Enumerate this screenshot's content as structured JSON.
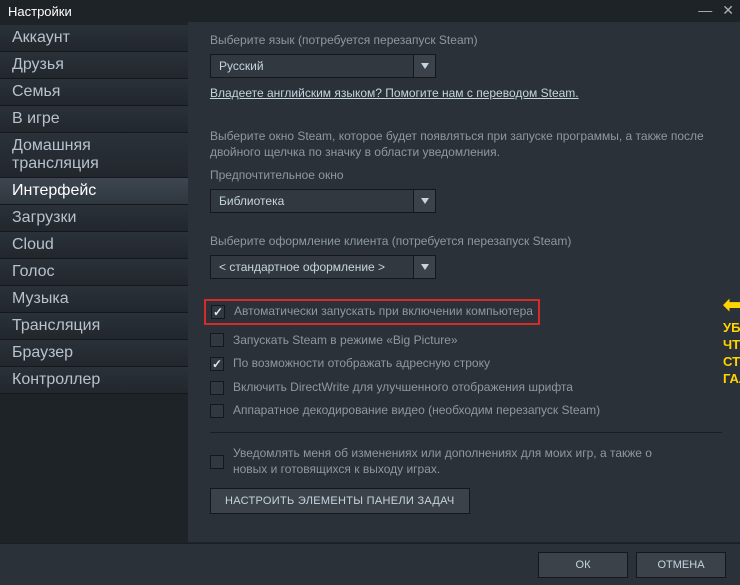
{
  "window": {
    "title": "Настройки"
  },
  "sidebar": {
    "items": [
      {
        "label": "Аккаунт"
      },
      {
        "label": "Друзья"
      },
      {
        "label": "Семья"
      },
      {
        "label": "В игре"
      },
      {
        "label": "Домашняя трансляция"
      },
      {
        "label": "Интерфейс"
      },
      {
        "label": "Загрузки"
      },
      {
        "label": "Cloud"
      },
      {
        "label": "Голос"
      },
      {
        "label": "Музыка"
      },
      {
        "label": "Трансляция"
      },
      {
        "label": "Браузер"
      },
      {
        "label": "Контроллер"
      }
    ],
    "active_index": 5
  },
  "main": {
    "lang_label": "Выберите язык (потребуется перезапуск Steam)",
    "lang_value": "Русский",
    "translate_link": "Владеете английским языком? Помогите нам с переводом Steam.",
    "window_label": "Выберите окно Steam, которое будет появляться при запуске программы, а также после двойного щелчка по значку в области уведомления.",
    "pref_window_label": "Предпочтительное окно",
    "pref_window_value": "Библиотека",
    "skin_label": "Выберите оформление клиента (потребуется перезапуск Steam)",
    "skin_value": "< стандартное оформление >",
    "checkboxes": [
      {
        "label": "Автоматически запускать при включении компьютера",
        "checked": true,
        "highlight": true
      },
      {
        "label": "Запускать Steam в режиме «Big Picture»",
        "checked": false
      },
      {
        "label": "По возможности отображать адресную строку",
        "checked": true
      },
      {
        "label": "Включить DirectWrite для улучшенного отображения шрифта",
        "checked": false
      },
      {
        "label": "Аппаратное декодирование видео (необходим перезапуск Steam)",
        "checked": false
      }
    ],
    "notify_label": "Уведомлять меня об изменениях или дополнениях для моих игр, а также о новых и готовящихся к выходу играх.",
    "notify_checked": false,
    "taskbar_button": "НАСТРОИТЬ ЭЛЕМЕНТЫ ПАНЕЛИ ЗАДАЧ"
  },
  "annotation": {
    "line1": "Убедитесь, что здесь",
    "line2": "стоит галочка!"
  },
  "footer": {
    "ok": "ОК",
    "cancel": "ОТМЕНА"
  }
}
